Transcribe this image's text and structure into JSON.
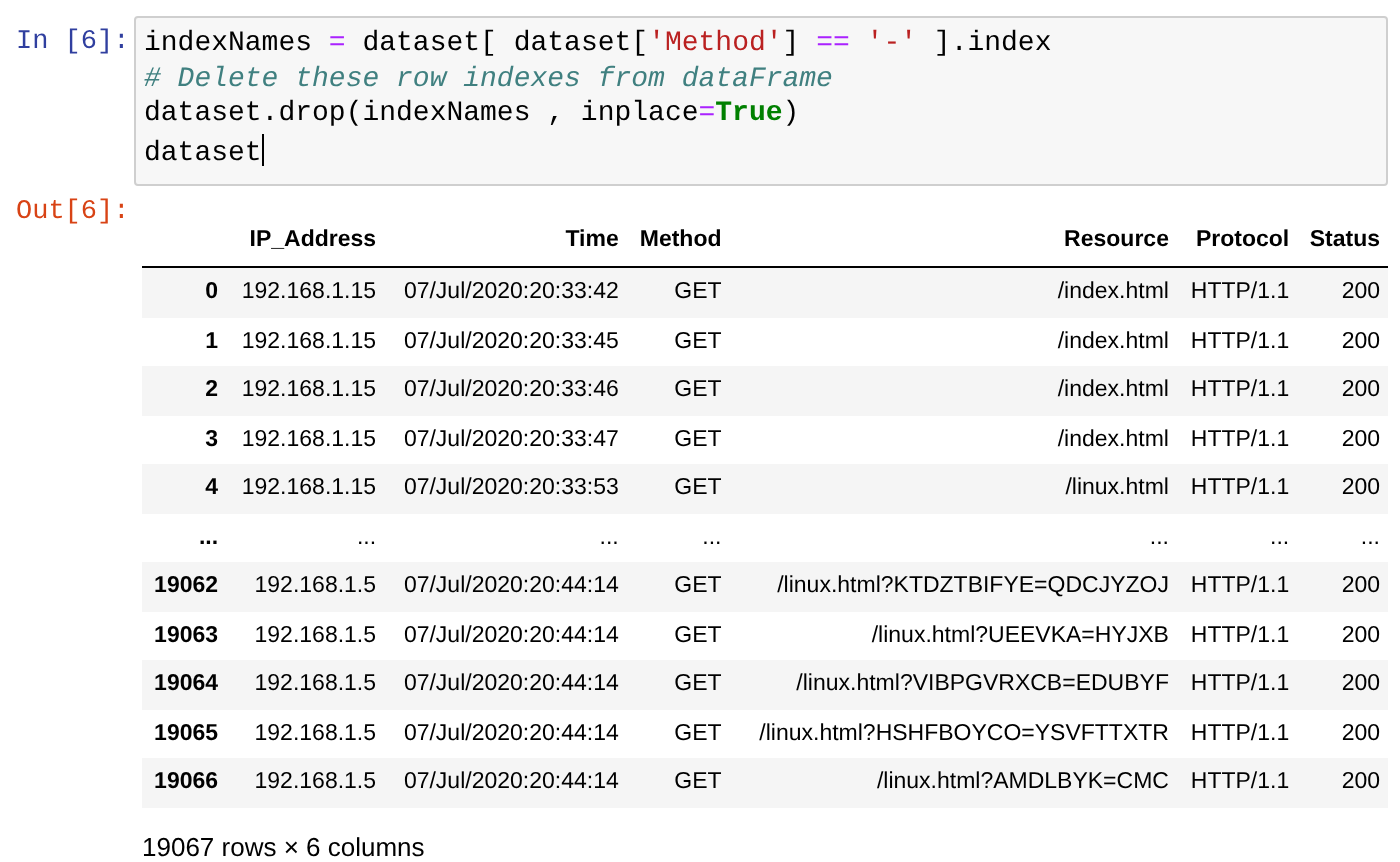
{
  "input_cell": {
    "prompt": "In [6]:",
    "lines": [
      {
        "cursor": false,
        "tokens": [
          {
            "kind": "plain",
            "text": "indexNames "
          },
          {
            "kind": "op",
            "text": "="
          },
          {
            "kind": "plain",
            "text": " dataset[ dataset["
          },
          {
            "kind": "string",
            "text": "'Method'"
          },
          {
            "kind": "plain",
            "text": "] "
          },
          {
            "kind": "op",
            "text": "=="
          },
          {
            "kind": "string",
            "text": " '-'"
          },
          {
            "kind": "plain",
            "text": " ].index"
          }
        ]
      },
      {
        "cursor": false,
        "tokens": [
          {
            "kind": "comment",
            "text": "# Delete these row indexes from dataFrame"
          }
        ]
      },
      {
        "cursor": false,
        "tokens": [
          {
            "kind": "plain",
            "text": "dataset.drop(indexNames , inplace"
          },
          {
            "kind": "op",
            "text": "="
          },
          {
            "kind": "keyword",
            "text": "True"
          },
          {
            "kind": "plain",
            "text": ")"
          }
        ]
      },
      {
        "cursor": true,
        "tokens": [
          {
            "kind": "plain",
            "text": "dataset"
          }
        ]
      }
    ]
  },
  "output_cell": {
    "prompt": "Out[6]:",
    "table": {
      "columns": [
        "",
        "IP_Address",
        "Time",
        "Method",
        "Resource",
        "Protocol",
        "Status"
      ],
      "rows": [
        [
          "0",
          "192.168.1.15",
          "07/Jul/2020:20:33:42",
          "GET",
          "/index.html",
          "HTTP/1.1",
          "200"
        ],
        [
          "1",
          "192.168.1.15",
          "07/Jul/2020:20:33:45",
          "GET",
          "/index.html",
          "HTTP/1.1",
          "200"
        ],
        [
          "2",
          "192.168.1.15",
          "07/Jul/2020:20:33:46",
          "GET",
          "/index.html",
          "HTTP/1.1",
          "200"
        ],
        [
          "3",
          "192.168.1.15",
          "07/Jul/2020:20:33:47",
          "GET",
          "/index.html",
          "HTTP/1.1",
          "200"
        ],
        [
          "4",
          "192.168.1.15",
          "07/Jul/2020:20:33:53",
          "GET",
          "/linux.html",
          "HTTP/1.1",
          "200"
        ],
        [
          "...",
          "...",
          "...",
          "...",
          "...",
          "...",
          "..."
        ],
        [
          "19062",
          "192.168.1.5",
          "07/Jul/2020:20:44:14",
          "GET",
          "/linux.html?KTDZTBIFYE=QDCJYZOJ",
          "HTTP/1.1",
          "200"
        ],
        [
          "19063",
          "192.168.1.5",
          "07/Jul/2020:20:44:14",
          "GET",
          "/linux.html?UEEVKA=HYJXB",
          "HTTP/1.1",
          "200"
        ],
        [
          "19064",
          "192.168.1.5",
          "07/Jul/2020:20:44:14",
          "GET",
          "/linux.html?VIBPGVRXCB=EDUBYF",
          "HTTP/1.1",
          "200"
        ],
        [
          "19065",
          "192.168.1.5",
          "07/Jul/2020:20:44:14",
          "GET",
          "/linux.html?HSHFBOYCO=YSVFTTXTR",
          "HTTP/1.1",
          "200"
        ],
        [
          "19066",
          "192.168.1.5",
          "07/Jul/2020:20:44:14",
          "GET",
          "/linux.html?AMDLBYK=CMC",
          "HTTP/1.1",
          "200"
        ]
      ]
    },
    "footer": "19067 rows × 6 columns"
  }
}
